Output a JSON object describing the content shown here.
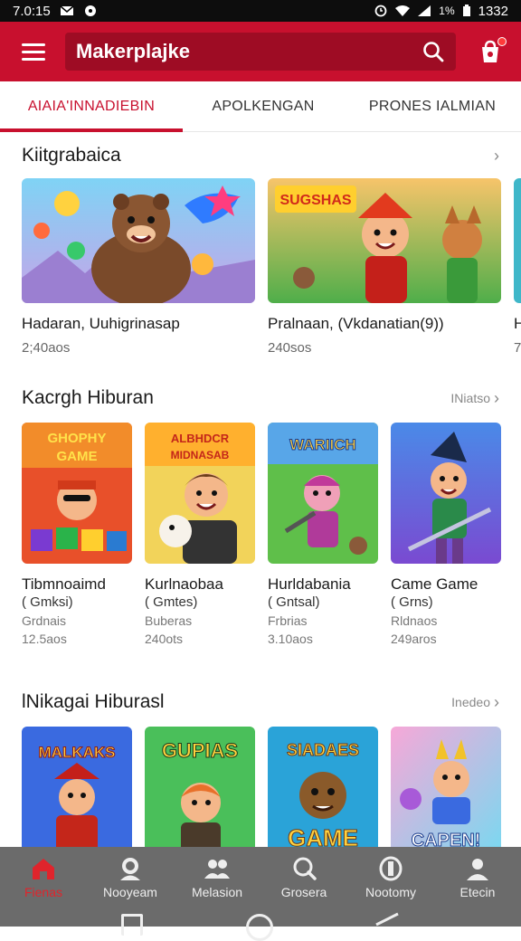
{
  "status_bar": {
    "time": "7.0:15",
    "battery": "1332",
    "signal": "1%"
  },
  "app_bar": {
    "search_text": "Makerplajke"
  },
  "tabs": [
    {
      "label": "AIAIA'INNADIEBIN",
      "active": true
    },
    {
      "label": "APOLKENGAN",
      "active": false
    },
    {
      "label": "PRONES IALMIAN",
      "active": false
    }
  ],
  "section1": {
    "title": "Kiitgrabaica",
    "cards": [
      {
        "title": "Hadaran, Uuhigrinasap",
        "size": "2;40aos"
      },
      {
        "title": "Pralnaan, (Vkdanatian(9))",
        "size": "240sos"
      }
    ]
  },
  "section2": {
    "title": "Kacrgh Hiburan",
    "more": "INiatso",
    "cards": [
      {
        "title": "Tibmnoaimd",
        "sub": "( Gmksi)",
        "meta": "Grdnais",
        "size": "12.5aos",
        "banner": "GHOPHY GAME"
      },
      {
        "title": "Kurlnaobaa",
        "sub": "( Gmtes)",
        "meta": "Buberas",
        "size": "240ots",
        "banner": "ALBHDCR MIDNASAB"
      },
      {
        "title": "Hurldabania",
        "sub": "( Gntsal)",
        "meta": "Frbrias",
        "size": "3.10aos",
        "banner": "WARIICH"
      },
      {
        "title": "Came Game",
        "sub": "( Grns)",
        "meta": "Rldnaos",
        "size": "249aros",
        "banner": ""
      }
    ]
  },
  "section3": {
    "title": "lNikagai Hiburasl",
    "more": "Inedeo",
    "cards": [
      {
        "banner": "MALKAKS"
      },
      {
        "banner": "GUPIAS"
      },
      {
        "banner": "SIADAES GAME"
      },
      {
        "banner": "CAPEN!"
      }
    ]
  },
  "bottom_nav": [
    {
      "label": "Fienas",
      "icon": "home-icon",
      "active": true
    },
    {
      "label": "Nooyeam",
      "icon": "search-person-icon",
      "active": false
    },
    {
      "label": "Melasion",
      "icon": "group-icon",
      "active": false
    },
    {
      "label": "Grosera",
      "icon": "magnifier-icon",
      "active": false
    },
    {
      "label": "Nootomy",
      "icon": "shield-icon",
      "active": false
    },
    {
      "label": "Etecin",
      "icon": "profile-icon",
      "active": false
    }
  ],
  "colors": {
    "brand": "#c8102e",
    "brand_dark": "#9e0c24",
    "nav_bg": "#6b6b6b"
  }
}
